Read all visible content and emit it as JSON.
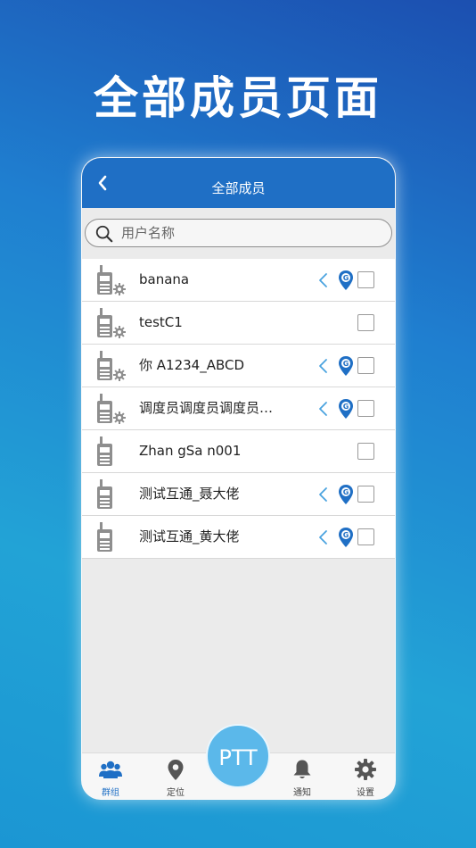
{
  "headline": "全部成员页面",
  "nav": {
    "title": "全部成员"
  },
  "search": {
    "placeholder": "用户名称"
  },
  "members": [
    {
      "name": "banana",
      "has_gear": true,
      "has_location": true
    },
    {
      "name": "testC1",
      "has_gear": true,
      "has_location": false
    },
    {
      "name": "你 A1234_ABCD",
      "has_gear": true,
      "has_location": true
    },
    {
      "name": "调度员调度员调度员调度员",
      "has_gear": true,
      "has_location": true
    },
    {
      "name": "Zhan gSa n001",
      "has_gear": false,
      "has_location": false
    },
    {
      "name": "测试互通_聂大佬",
      "has_gear": false,
      "has_location": true
    },
    {
      "name": "测试互通_黄大佬",
      "has_gear": false,
      "has_location": true
    }
  ],
  "ptt_label": "PTT",
  "tabs": [
    {
      "label": "群组",
      "icon": "group-icon",
      "active": true
    },
    {
      "label": "定位",
      "icon": "location-icon",
      "active": false
    },
    {
      "label": "通知",
      "icon": "bell-icon",
      "active": false
    },
    {
      "label": "设置",
      "icon": "gear-icon",
      "active": false
    }
  ],
  "colors": {
    "primary": "#1f6fc5",
    "ptt": "#5bb8ea",
    "location_pin": "#1f6fc5",
    "arrow": "#4aa3df"
  }
}
